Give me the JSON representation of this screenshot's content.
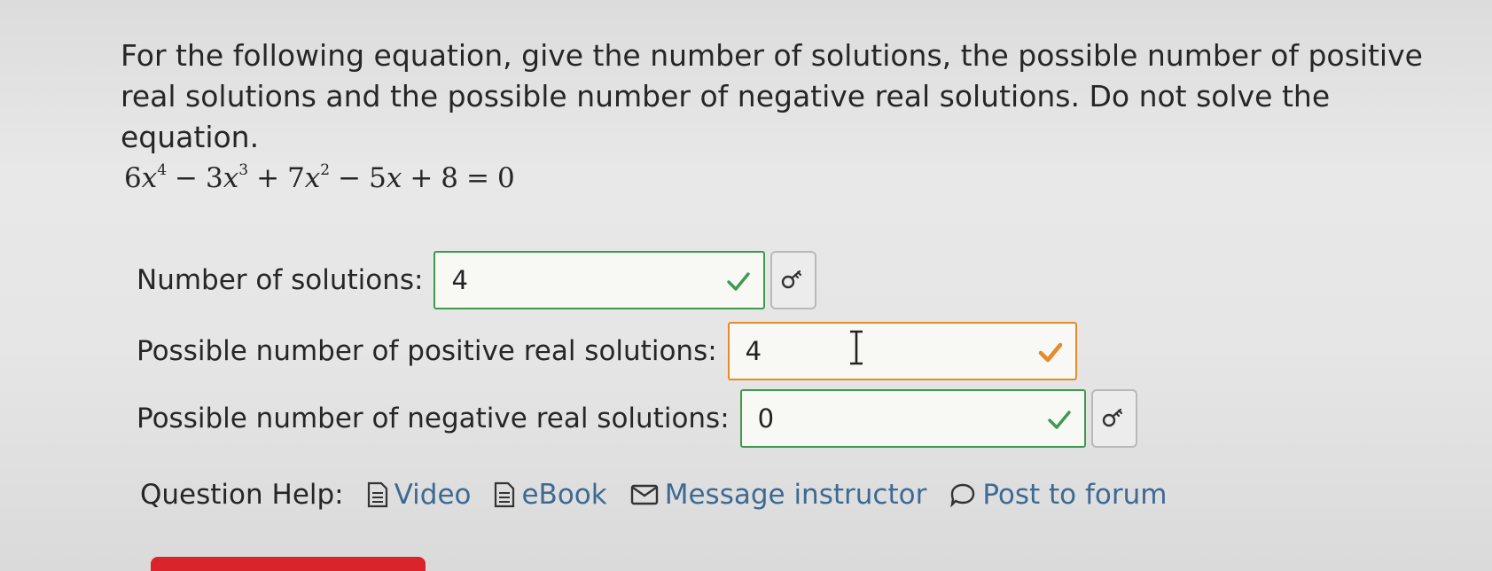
{
  "question": {
    "text": "For the following equation, give the number of solutions, the possible number of positive real solutions and the possible number of negative real solutions. Do not solve the equation."
  },
  "equation": {
    "c4": "6",
    "e4": "4",
    "c3": "3",
    "e3": "3",
    "c2": "7",
    "e2": "2",
    "c1": "5",
    "c0": "8",
    "rhs": "0",
    "variable": "x"
  },
  "answers": [
    {
      "label": "Number of solutions:",
      "value": "4",
      "status": "correct",
      "status_icon": "check-icon",
      "key_icon": "key-icon"
    },
    {
      "label": "Possible number of positive real solutions:",
      "value": "4",
      "status": "partially-correct",
      "status_icon": "check-icon"
    },
    {
      "label": "Possible number of negative real solutions:",
      "value": "0",
      "status": "correct",
      "status_icon": "check-icon",
      "key_icon": "key-icon"
    }
  ],
  "help": {
    "label": "Question Help:",
    "links": [
      {
        "label": "Video",
        "icon": "document-icon"
      },
      {
        "label": "eBook",
        "icon": "document-icon"
      },
      {
        "label": "Message instructor",
        "icon": "envelope-icon"
      },
      {
        "label": "Post to forum",
        "icon": "speech-bubble-icon"
      }
    ]
  },
  "colors": {
    "correct": "#3e9a4f",
    "partial": "#e58b2c",
    "link": "#3d6a93",
    "submit": "#d8242a"
  }
}
